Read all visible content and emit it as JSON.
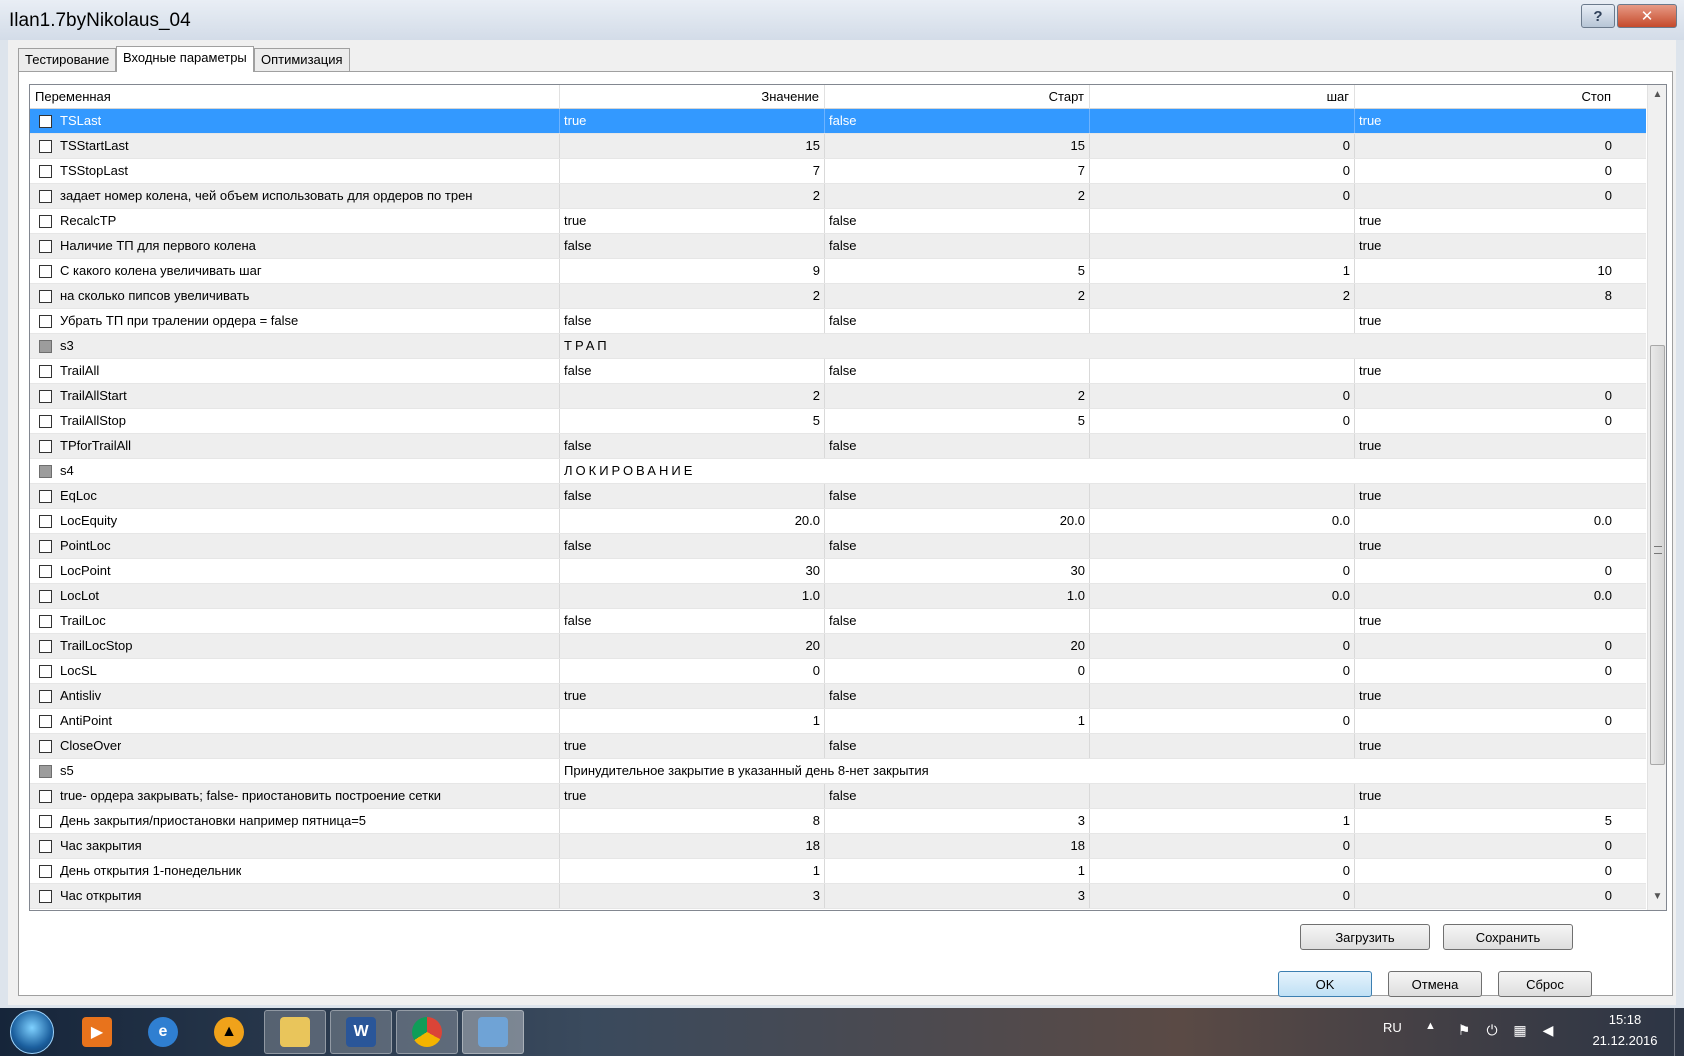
{
  "window": {
    "title": "Ilan1.7byNikolaus_04",
    "help_glyph": "?",
    "close_glyph": "✕"
  },
  "tabs": [
    {
      "label": "Тестирование"
    },
    {
      "label": "Входные параметры"
    },
    {
      "label": "Оптимизация"
    }
  ],
  "table": {
    "columns": [
      "Переменная",
      "Значение",
      "Старт",
      "шаг",
      "Стоп"
    ],
    "rows": [
      {
        "name": "TSLast",
        "type": "bool",
        "value": "true",
        "start": "false",
        "step": "",
        "stop": "true"
      },
      {
        "name": "TSStartLast",
        "type": "num",
        "value": "15",
        "start": "15",
        "step": "0",
        "stop": "0"
      },
      {
        "name": "TSStopLast",
        "type": "num",
        "value": "7",
        "start": "7",
        "step": "0",
        "stop": "0"
      },
      {
        "name": "задает номер колена, чей объем использовать для ордеров по трен",
        "type": "num",
        "value": "2",
        "start": "2",
        "step": "0",
        "stop": "0"
      },
      {
        "name": "RecalcTP",
        "type": "bool",
        "value": "true",
        "start": "false",
        "step": "",
        "stop": "true"
      },
      {
        "name": "Наличие ТП для первого колена",
        "type": "bool",
        "value": "false",
        "start": "false",
        "step": "",
        "stop": "true"
      },
      {
        "name": "С какого колена увеличивать шаг",
        "type": "num",
        "value": "9",
        "start": "5",
        "step": "1",
        "stop": "10"
      },
      {
        "name": "на сколько пипсов увеличивать",
        "type": "num",
        "value": "2",
        "start": "2",
        "step": "2",
        "stop": "8"
      },
      {
        "name": "Убрать ТП при тралении ордера = false",
        "type": "bool",
        "value": "false",
        "start": "false",
        "step": "",
        "stop": "true"
      },
      {
        "name": "s3",
        "type": "section",
        "value": "ТРАП"
      },
      {
        "name": "TrailAll",
        "type": "bool",
        "value": "false",
        "start": "false",
        "step": "",
        "stop": "true"
      },
      {
        "name": "TrailAllStart",
        "type": "num",
        "value": "2",
        "start": "2",
        "step": "0",
        "stop": "0"
      },
      {
        "name": "TrailAllStop",
        "type": "num",
        "value": "5",
        "start": "5",
        "step": "0",
        "stop": "0"
      },
      {
        "name": "TPforTrailAll",
        "type": "bool",
        "value": "false",
        "start": "false",
        "step": "",
        "stop": "true"
      },
      {
        "name": "s4",
        "type": "section",
        "value": "ЛОКИРОВАНИЕ"
      },
      {
        "name": "EqLoc",
        "type": "bool",
        "value": "false",
        "start": "false",
        "step": "",
        "stop": "true"
      },
      {
        "name": "LocEquity",
        "type": "num",
        "value": "20.0",
        "start": "20.0",
        "step": "0.0",
        "stop": "0.0"
      },
      {
        "name": "PointLoc",
        "type": "bool",
        "value": "false",
        "start": "false",
        "step": "",
        "stop": "true"
      },
      {
        "name": "LocPoint",
        "type": "num",
        "value": "30",
        "start": "30",
        "step": "0",
        "stop": "0"
      },
      {
        "name": "LocLot",
        "type": "num",
        "value": "1.0",
        "start": "1.0",
        "step": "0.0",
        "stop": "0.0"
      },
      {
        "name": "TrailLoc",
        "type": "bool",
        "value": "false",
        "start": "false",
        "step": "",
        "stop": "true"
      },
      {
        "name": "TrailLocStop",
        "type": "num",
        "value": "20",
        "start": "20",
        "step": "0",
        "stop": "0"
      },
      {
        "name": "LocSL",
        "type": "num",
        "value": "0",
        "start": "0",
        "step": "0",
        "stop": "0"
      },
      {
        "name": "Antisliv",
        "type": "bool",
        "value": "true",
        "start": "false",
        "step": "",
        "stop": "true"
      },
      {
        "name": "AntiPoint",
        "type": "num",
        "value": "1",
        "start": "1",
        "step": "0",
        "stop": "0"
      },
      {
        "name": "CloseOver",
        "type": "bool",
        "value": "true",
        "start": "false",
        "step": "",
        "stop": "true"
      },
      {
        "name": "s5",
        "type": "section",
        "value": "Принудительное закрытие в указанный день 8-нет закрытия"
      },
      {
        "name": "true- ордера закрывать; false- приостановить построение сетки",
        "type": "bool",
        "value": "true",
        "start": "false",
        "step": "",
        "stop": "true"
      },
      {
        "name": "День закрытия/приостановки например пятница=5",
        "type": "num",
        "value": "8",
        "start": "3",
        "step": "1",
        "stop": "5"
      },
      {
        "name": "Час закрытия",
        "type": "num",
        "value": "18",
        "start": "18",
        "step": "0",
        "stop": "0"
      },
      {
        "name": "День открытия 1-понедельник",
        "type": "num",
        "value": "1",
        "start": "1",
        "step": "0",
        "stop": "0"
      },
      {
        "name": "Час открытия",
        "type": "num",
        "value": "3",
        "start": "3",
        "step": "0",
        "stop": "0"
      }
    ]
  },
  "buttons": {
    "load": "Загрузить",
    "save": "Сохранить",
    "ok": "OK",
    "cancel": "Отмена",
    "reset": "Сброс"
  },
  "taskbar": {
    "word_letter": "W",
    "language": "RU",
    "time": "15:18",
    "date": "21.12.2016"
  }
}
